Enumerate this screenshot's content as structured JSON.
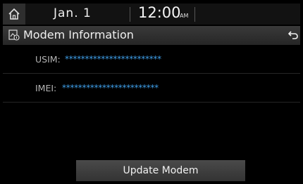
{
  "status": {
    "date": "Jan. 1",
    "time": "12:00",
    "ampm": "AM"
  },
  "title": "Modem Information",
  "info": {
    "usim_label": "USIM:",
    "usim_value": "************************",
    "imei_label": "IMEI:",
    "imei_value": "************************"
  },
  "buttons": {
    "update": "Update Modem"
  },
  "colors": {
    "value_blue": "#3e9ee8",
    "background": "#000000"
  },
  "icons": {
    "home": "home-icon",
    "modem": "modem-info-icon",
    "back": "back-icon"
  }
}
